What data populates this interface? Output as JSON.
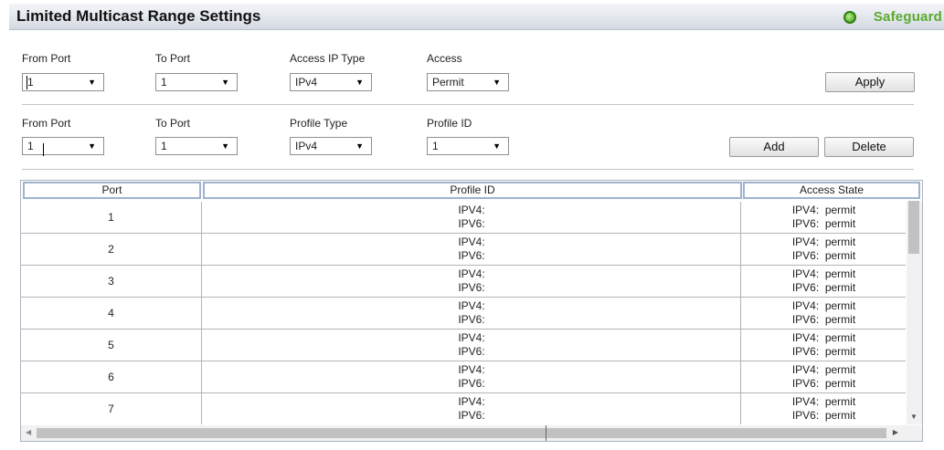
{
  "header": {
    "title": "Limited Multicast Range Settings",
    "safeguard": "Safeguard",
    "safeguard_icon": "status-circle-icon"
  },
  "form1": {
    "from_port_label": "From Port",
    "from_port_value": "1",
    "to_port_label": "To Port",
    "to_port_value": "1",
    "access_ip_type_label": "Access IP Type",
    "access_ip_type_value": "IPv4",
    "access_label": "Access",
    "access_value": "Permit",
    "apply_label": "Apply"
  },
  "form2": {
    "from_port_label": "From Port",
    "from_port_value": "1",
    "to_port_label": "To Port",
    "to_port_value": "1",
    "profile_type_label": "Profile Type",
    "profile_type_value": "IPv4",
    "profile_id_label": "Profile ID",
    "profile_id_value": "1",
    "add_label": "Add",
    "delete_label": "Delete"
  },
  "dropdown_arrow": "▼",
  "table": {
    "columns": [
      "Port",
      "Profile ID",
      "Access State"
    ],
    "rows": [
      {
        "port": "1",
        "profile_ipv4": "IPV4:",
        "profile_ipv6": "IPV6:",
        "access_ipv4": "IPV4:  permit",
        "access_ipv6": "IPV6:  permit"
      },
      {
        "port": "2",
        "profile_ipv4": "IPV4:",
        "profile_ipv6": "IPV6:",
        "access_ipv4": "IPV4:  permit",
        "access_ipv6": "IPV6:  permit"
      },
      {
        "port": "3",
        "profile_ipv4": "IPV4:",
        "profile_ipv6": "IPV6:",
        "access_ipv4": "IPV4:  permit",
        "access_ipv6": "IPV6:  permit"
      },
      {
        "port": "4",
        "profile_ipv4": "IPV4:",
        "profile_ipv6": "IPV6:",
        "access_ipv4": "IPV4:  permit",
        "access_ipv6": "IPV6:  permit"
      },
      {
        "port": "5",
        "profile_ipv4": "IPV4:",
        "profile_ipv6": "IPV6:",
        "access_ipv4": "IPV4:  permit",
        "access_ipv6": "IPV6:  permit"
      },
      {
        "port": "6",
        "profile_ipv4": "IPV4:",
        "profile_ipv6": "IPV6:",
        "access_ipv4": "IPV4:  permit",
        "access_ipv6": "IPV6:  permit"
      },
      {
        "port": "7",
        "profile_ipv4": "IPV4:",
        "profile_ipv6": "IPV6:",
        "access_ipv4": "IPV4:  permit",
        "access_ipv6": "IPV6:  permit"
      }
    ]
  },
  "colors": {
    "safeguard_green": "#5ba92e",
    "header_border": "#9fb3cf"
  }
}
